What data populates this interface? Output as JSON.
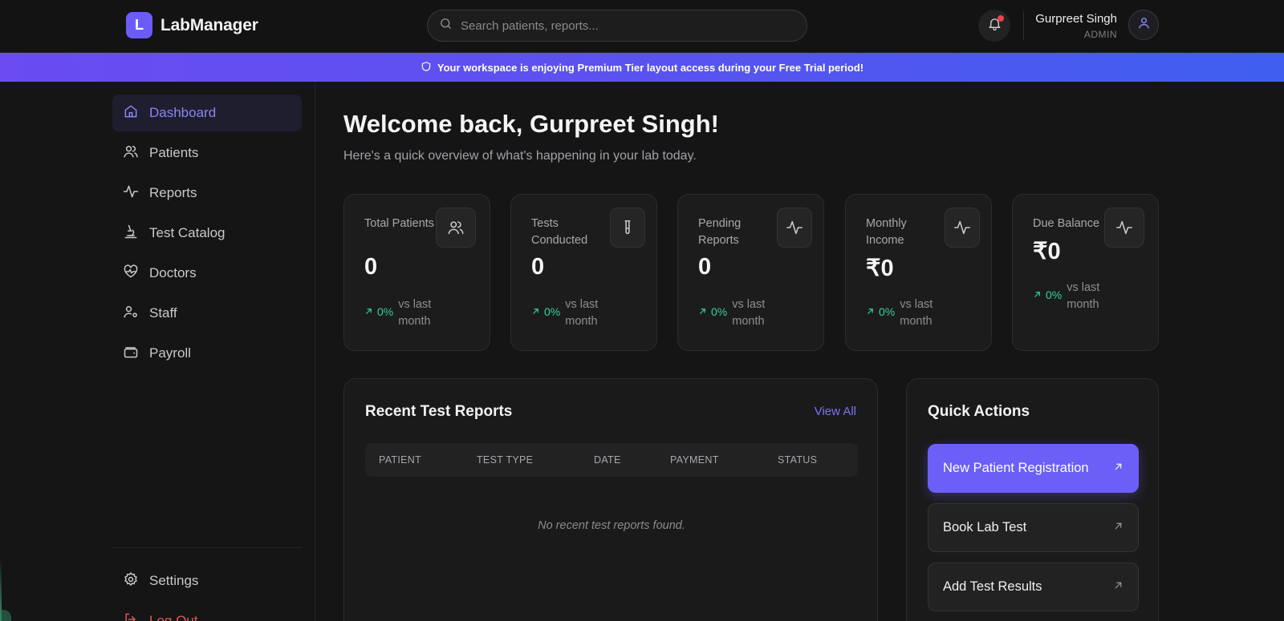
{
  "header": {
    "logo_letter": "L",
    "app_name": "LabManager",
    "search_placeholder": "Search patients, reports...",
    "user_name": "Gurpreet Singh",
    "user_role": "ADMIN"
  },
  "banner": {
    "text": "Your workspace is enjoying Premium Tier layout access during your Free Trial period!"
  },
  "sidebar": {
    "items": [
      {
        "label": "Dashboard",
        "icon": "home-icon",
        "active": true
      },
      {
        "label": "Patients",
        "icon": "users-icon"
      },
      {
        "label": "Reports",
        "icon": "activity-icon"
      },
      {
        "label": "Test Catalog",
        "icon": "microscope-icon"
      },
      {
        "label": "Doctors",
        "icon": "heart-pulse-icon"
      },
      {
        "label": "Staff",
        "icon": "user-cog-icon"
      },
      {
        "label": "Payroll",
        "icon": "wallet-icon"
      }
    ],
    "settings_label": "Settings",
    "logout_label": "Log Out"
  },
  "main": {
    "welcome": "Welcome back, Gurpreet Singh!",
    "subtitle": "Here's a quick overview of what's happening in your lab today."
  },
  "stats": [
    {
      "label": "Total Patients",
      "value": "0",
      "trend": "0%",
      "note": "vs last month",
      "icon": "users-icon"
    },
    {
      "label": "Tests Conducted",
      "value": "0",
      "trend": "0%",
      "note": "vs last month",
      "icon": "test-tube-icon"
    },
    {
      "label": "Pending Reports",
      "value": "0",
      "trend": "0%",
      "note": "vs last month",
      "icon": "activity-icon"
    },
    {
      "label": "Monthly Income",
      "value": "₹0",
      "trend": "0%",
      "note": "vs last month",
      "icon": "activity-icon"
    },
    {
      "label": "Due Balance",
      "value": "₹0",
      "trend": "0%",
      "note": "vs last month",
      "icon": "activity-icon"
    }
  ],
  "recent_reports": {
    "title": "Recent Test Reports",
    "view_all": "View All",
    "columns": [
      "PATIENT",
      "TEST TYPE",
      "DATE",
      "PAYMENT",
      "STATUS"
    ],
    "empty_text": "No recent test reports found."
  },
  "quick_actions": {
    "title": "Quick Actions",
    "buttons": [
      {
        "label": "New Patient Registration",
        "primary": true
      },
      {
        "label": "Book Lab Test"
      },
      {
        "label": "Add Test Results"
      }
    ]
  },
  "colors": {
    "accent": "#6b5ff7",
    "positive": "#34d399",
    "danger": "#ef4444"
  }
}
